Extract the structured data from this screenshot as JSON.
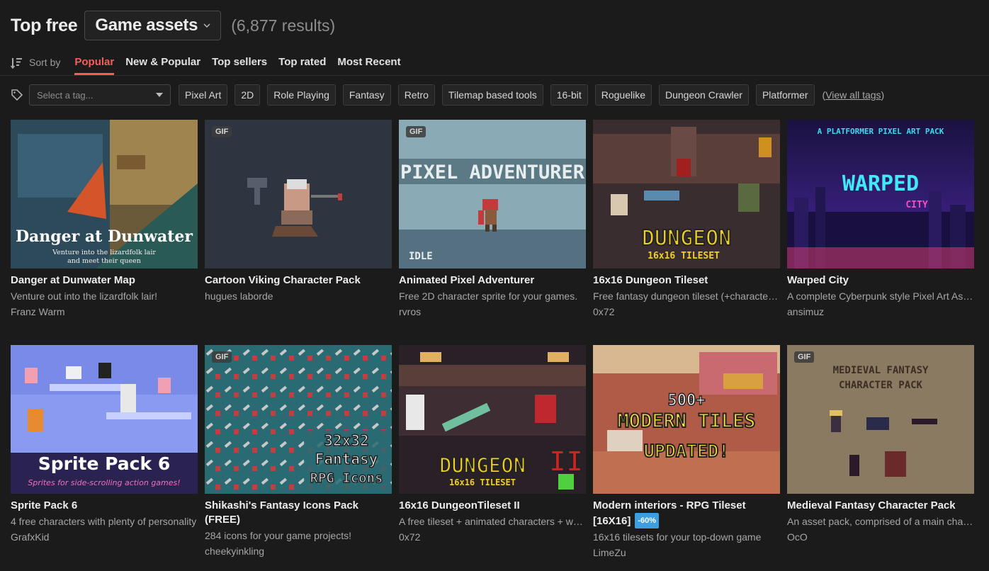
{
  "header": {
    "title": "Top free",
    "category": "Game assets",
    "results": "(6,877 results)"
  },
  "sort": {
    "label": "Sort by",
    "tabs": [
      "Popular",
      "New & Popular",
      "Top sellers",
      "Top rated",
      "Most Recent"
    ],
    "active": "Popular"
  },
  "tags": {
    "placeholder": "Select a tag...",
    "chips": [
      "Pixel Art",
      "2D",
      "Role Playing",
      "Fantasy",
      "Retro",
      "Tilemap based tools",
      "16-bit",
      "Roguelike",
      "Dungeon Crawler",
      "Platformer"
    ],
    "view_all": "View all tags"
  },
  "games": [
    {
      "title": "Danger at Dunwater Map",
      "desc": "Venture out into the lizardfolk lair!",
      "author": "Franz Warm",
      "gif": "",
      "thumb_text": [
        "Danger at Dunwater",
        "Venture into the lizardfolk lair",
        "and meet their queen"
      ]
    },
    {
      "title": "Cartoon Viking Character Pack",
      "desc": "",
      "author": "hugues laborde",
      "gif": "GIF",
      "thumb_text": []
    },
    {
      "title": "Animated Pixel Adventurer",
      "desc": "Free 2D character sprite for your games.",
      "author": "rvros",
      "gif": "GIF",
      "thumb_text": [
        "PIXEL ADVENTURER",
        "IDLE"
      ]
    },
    {
      "title": "16x16 Dungeon Tileset",
      "desc": "Free fantasy dungeon tileset (+characters…",
      "author": "0x72",
      "gif": "",
      "thumb_text": [
        "DUNGEON",
        "16x16 TILESET"
      ]
    },
    {
      "title": "Warped City",
      "desc": "A complete Cyberpunk style Pixel Art Ass…",
      "author": "ansimuz",
      "gif": "",
      "thumb_text": [
        "A PLATFORMER PIXEL ART PACK",
        "WARPED",
        "CITY"
      ]
    },
    {
      "title": "Sprite Pack 6",
      "desc": "4 free characters with plenty of personality",
      "author": "GrafxKid",
      "gif": "",
      "thumb_text": [
        "Sprite Pack 6",
        "Sprites for side-scrolling action games!"
      ]
    },
    {
      "title": "Shikashi's Fantasy Icons Pack (FREE)",
      "desc": "284 icons for your game projects!",
      "author": "cheekyinkling",
      "gif": "GIF",
      "thumb_text": [
        "32x32",
        "Fantasy",
        "RPG Icons"
      ]
    },
    {
      "title": "16x16 DungeonTileset II",
      "desc": "A free tileset + animated characters + we…",
      "author": "0x72",
      "gif": "",
      "thumb_text": [
        "DUNGEON",
        "16x16 TILESET",
        "II"
      ]
    },
    {
      "title": "Modern interiors - RPG Tileset [16X16]",
      "desc": "16x16 tilesets for your top-down game",
      "author": "LimeZu",
      "gif": "",
      "sale": "-60%",
      "thumb_text": [
        "500+",
        "MODERN TILES",
        "UPDATED!"
      ]
    },
    {
      "title": "Medieval Fantasy Character Pack",
      "desc": "An asset pack, comprised of a main charac…",
      "author": "OcO",
      "gif": "GIF",
      "thumb_text": [
        "MEDIEVAL FANTASY",
        "CHARACTER PACK"
      ]
    }
  ],
  "colors": {
    "accent": "#fa5c5c",
    "sale": "#3d9fe0",
    "background": "#1b1b1c"
  }
}
